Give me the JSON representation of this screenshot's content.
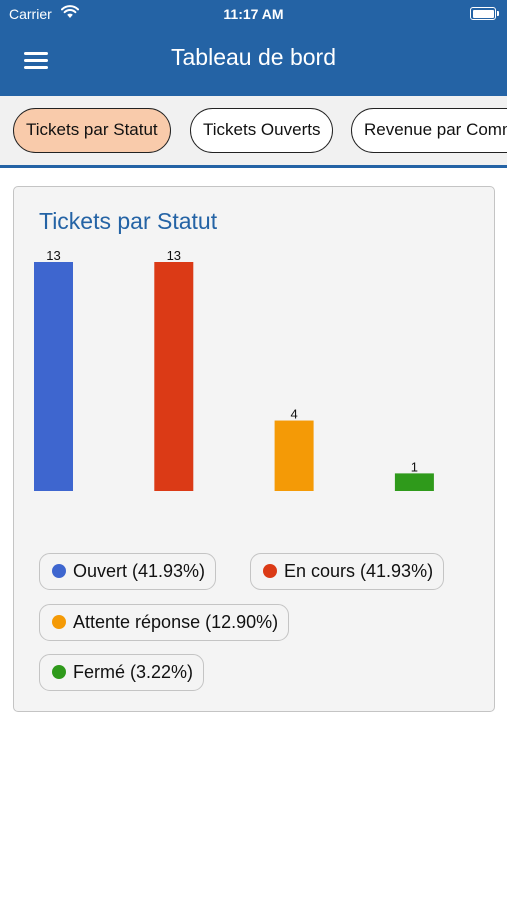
{
  "status_bar": {
    "carrier": "Carrier",
    "time": "11:17 AM"
  },
  "navbar": {
    "title": "Tableau de bord"
  },
  "tabs": [
    {
      "label": "Tickets par Statut",
      "active": true
    },
    {
      "label": "Tickets Ouverts",
      "active": false
    },
    {
      "label": "Revenue par Comm",
      "active": false
    }
  ],
  "colors": {
    "header": "#2463a5",
    "active_tab": "#f9cbab"
  },
  "card": {
    "title": "Tickets par Statut"
  },
  "chart_data": {
    "type": "bar",
    "title": "Tickets par Statut",
    "categories": [
      "Ouvert",
      "En cours",
      "Attente réponse",
      "Fermé"
    ],
    "values": [
      13,
      13,
      4,
      1
    ],
    "colors": [
      "#3e66cf",
      "#db3a16",
      "#f49a06",
      "#2f9a1b"
    ],
    "ylim": [
      0,
      13
    ],
    "grid": false,
    "legend_position": "bottom",
    "legend": [
      {
        "label": "Ouvert (41.93%)",
        "color": "#3e66cf"
      },
      {
        "label": "En cours (41.93%)",
        "color": "#db3a16"
      },
      {
        "label": "Attente réponse (12.90%)",
        "color": "#f49a06"
      },
      {
        "label": "Fermé (3.22%)",
        "color": "#2f9a1b"
      }
    ]
  }
}
